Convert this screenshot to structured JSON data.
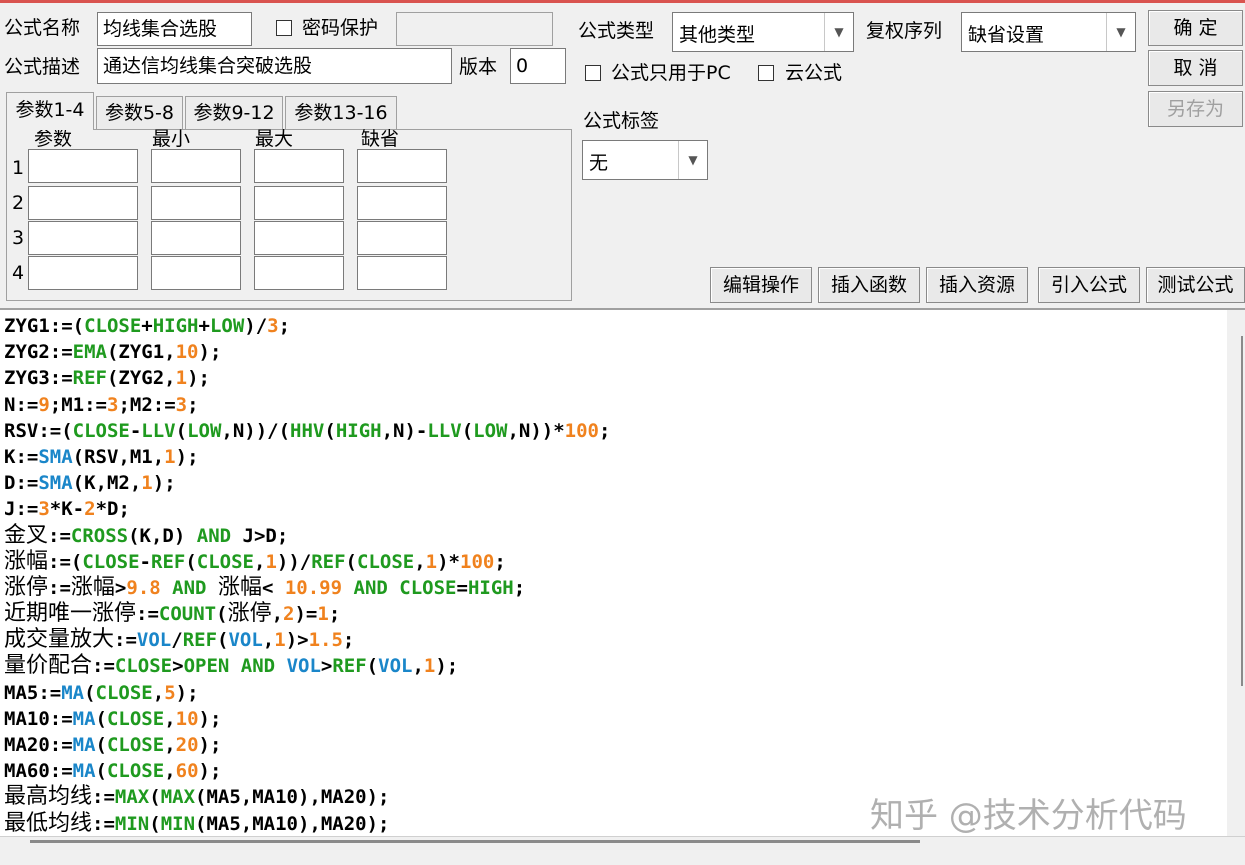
{
  "form": {
    "name_label": "公式名称",
    "name_value": "均线集合选股",
    "password_label": "密码保护",
    "desc_label": "公式描述",
    "desc_value": "通达信均线集合突破选股",
    "version_label": "版本",
    "version_value": "0",
    "type_label": "公式类型",
    "type_value": "其他类型",
    "rights_label": "复权序列",
    "rights_value": "缺省设置",
    "pc_only_label": "公式只用于PC",
    "cloud_label": "云公式",
    "tag_label": "公式标签",
    "tag_value": "无"
  },
  "buttons": {
    "ok": "确 定",
    "cancel": "取 消",
    "save_as": "另存为",
    "edit_ops": "编辑操作",
    "insert_func": "插入函数",
    "insert_res": "插入资源",
    "import_formula": "引入公式",
    "test_formula": "测试公式"
  },
  "params": {
    "tabs": [
      "参数1-4",
      "参数5-8",
      "参数9-12",
      "参数13-16"
    ],
    "headers": [
      "参数",
      "最小",
      "最大",
      "缺省"
    ],
    "rows": [
      "1",
      "2",
      "3",
      "4"
    ]
  },
  "colors": {
    "keyword": "#1f9a1f",
    "number": "#f0821e",
    "func_blue": "#1a86c9",
    "plain": "#000000"
  },
  "code_lines": [
    [
      [
        "ZYG1:=(",
        "p"
      ],
      [
        "CLOSE",
        "g"
      ],
      [
        "+",
        "p"
      ],
      [
        "HIGH",
        "g"
      ],
      [
        "+",
        "p"
      ],
      [
        "LOW",
        "g"
      ],
      [
        ")/",
        "p"
      ],
      [
        "3",
        "o"
      ],
      [
        ";",
        "p"
      ]
    ],
    [
      [
        "ZYG2:=",
        "p"
      ],
      [
        "EMA",
        "g"
      ],
      [
        "(ZYG1,",
        "p"
      ],
      [
        "10",
        "o"
      ],
      [
        ");",
        "p"
      ]
    ],
    [
      [
        "ZYG3:=",
        "p"
      ],
      [
        "REF",
        "g"
      ],
      [
        "(ZYG2,",
        "p"
      ],
      [
        "1",
        "o"
      ],
      [
        ");",
        "p"
      ]
    ],
    [
      [
        "N:=",
        "p"
      ],
      [
        "9",
        "o"
      ],
      [
        ";M1:=",
        "p"
      ],
      [
        "3",
        "o"
      ],
      [
        ";M2:=",
        "p"
      ],
      [
        "3",
        "o"
      ],
      [
        ";",
        "p"
      ]
    ],
    [
      [
        "RSV:=(",
        "p"
      ],
      [
        "CLOSE",
        "g"
      ],
      [
        "-",
        "p"
      ],
      [
        "LLV",
        "g"
      ],
      [
        "(",
        "p"
      ],
      [
        "LOW",
        "g"
      ],
      [
        ",N))/(",
        "p"
      ],
      [
        "HHV",
        "g"
      ],
      [
        "(",
        "p"
      ],
      [
        "HIGH",
        "g"
      ],
      [
        ",N)-",
        "p"
      ],
      [
        "LLV",
        "g"
      ],
      [
        "(",
        "p"
      ],
      [
        "LOW",
        "g"
      ],
      [
        ",N))*",
        "p"
      ],
      [
        "100",
        "o"
      ],
      [
        ";",
        "p"
      ]
    ],
    [
      [
        "K:=",
        "p"
      ],
      [
        "SMA",
        "b"
      ],
      [
        "(RSV,M1,",
        "p"
      ],
      [
        "1",
        "o"
      ],
      [
        ");",
        "p"
      ]
    ],
    [
      [
        "D:=",
        "p"
      ],
      [
        "SMA",
        "b"
      ],
      [
        "(K,M2,",
        "p"
      ],
      [
        "1",
        "o"
      ],
      [
        ");",
        "p"
      ]
    ],
    [
      [
        "J:=",
        "p"
      ],
      [
        "3",
        "o"
      ],
      [
        "*K-",
        "p"
      ],
      [
        "2",
        "o"
      ],
      [
        "*D;",
        "p"
      ]
    ],
    [
      [
        "金叉",
        "p"
      ],
      [
        ":=",
        "p"
      ],
      [
        "CROSS",
        "g"
      ],
      [
        "(K,D) ",
        "p"
      ],
      [
        "AND",
        "g"
      ],
      [
        " J>D;",
        "p"
      ]
    ],
    [
      [
        "涨幅",
        "p"
      ],
      [
        ":=(",
        "p"
      ],
      [
        "CLOSE",
        "g"
      ],
      [
        "-",
        "p"
      ],
      [
        "REF",
        "g"
      ],
      [
        "(",
        "p"
      ],
      [
        "CLOSE",
        "g"
      ],
      [
        ",",
        "p"
      ],
      [
        "1",
        "o"
      ],
      [
        "))/",
        "p"
      ],
      [
        "REF",
        "g"
      ],
      [
        "(",
        "p"
      ],
      [
        "CLOSE",
        "g"
      ],
      [
        ",",
        "p"
      ],
      [
        "1",
        "o"
      ],
      [
        ")*",
        "p"
      ],
      [
        "100",
        "o"
      ],
      [
        ";",
        "p"
      ]
    ],
    [
      [
        "涨停",
        "p"
      ],
      [
        ":=",
        "p"
      ],
      [
        "涨幅",
        "p"
      ],
      [
        ">",
        "p"
      ],
      [
        "9.8",
        "o"
      ],
      [
        " ",
        "p"
      ],
      [
        "AND",
        "g"
      ],
      [
        " ",
        "p"
      ],
      [
        "涨幅",
        "p"
      ],
      [
        "< ",
        "p"
      ],
      [
        "10.99",
        "o"
      ],
      [
        " ",
        "p"
      ],
      [
        "AND",
        "g"
      ],
      [
        " ",
        "p"
      ],
      [
        "CLOSE",
        "g"
      ],
      [
        "=",
        "p"
      ],
      [
        "HIGH",
        "g"
      ],
      [
        ";",
        "p"
      ]
    ],
    [
      [
        "近期唯一涨停",
        "p"
      ],
      [
        ":=",
        "p"
      ],
      [
        "COUNT",
        "g"
      ],
      [
        "(",
        "p"
      ],
      [
        "涨停",
        "p"
      ],
      [
        ",",
        "p"
      ],
      [
        "2",
        "o"
      ],
      [
        ")=",
        "p"
      ],
      [
        "1",
        "o"
      ],
      [
        ";",
        "p"
      ]
    ],
    [
      [
        "成交量放大",
        "p"
      ],
      [
        ":=",
        "p"
      ],
      [
        "VOL",
        "b"
      ],
      [
        "/",
        "p"
      ],
      [
        "REF",
        "g"
      ],
      [
        "(",
        "p"
      ],
      [
        "VOL",
        "b"
      ],
      [
        ",",
        "p"
      ],
      [
        "1",
        "o"
      ],
      [
        ")>",
        "p"
      ],
      [
        "1.5",
        "o"
      ],
      [
        ";",
        "p"
      ]
    ],
    [
      [
        "量价配合",
        "p"
      ],
      [
        ":=",
        "p"
      ],
      [
        "CLOSE",
        "g"
      ],
      [
        ">",
        "p"
      ],
      [
        "OPEN",
        "g"
      ],
      [
        " ",
        "p"
      ],
      [
        "AND",
        "g"
      ],
      [
        " ",
        "p"
      ],
      [
        "VOL",
        "b"
      ],
      [
        ">",
        "p"
      ],
      [
        "REF",
        "g"
      ],
      [
        "(",
        "p"
      ],
      [
        "VOL",
        "b"
      ],
      [
        ",",
        "p"
      ],
      [
        "1",
        "o"
      ],
      [
        ");",
        "p"
      ]
    ],
    [
      [
        "MA5:=",
        "p"
      ],
      [
        "MA",
        "b"
      ],
      [
        "(",
        "p"
      ],
      [
        "CLOSE",
        "g"
      ],
      [
        ",",
        "p"
      ],
      [
        "5",
        "o"
      ],
      [
        ");",
        "p"
      ]
    ],
    [
      [
        "MA10:=",
        "p"
      ],
      [
        "MA",
        "b"
      ],
      [
        "(",
        "p"
      ],
      [
        "CLOSE",
        "g"
      ],
      [
        ",",
        "p"
      ],
      [
        "10",
        "o"
      ],
      [
        ");",
        "p"
      ]
    ],
    [
      [
        "MA20:=",
        "p"
      ],
      [
        "MA",
        "b"
      ],
      [
        "(",
        "p"
      ],
      [
        "CLOSE",
        "g"
      ],
      [
        ",",
        "p"
      ],
      [
        "20",
        "o"
      ],
      [
        ");",
        "p"
      ]
    ],
    [
      [
        "MA60:=",
        "p"
      ],
      [
        "MA",
        "b"
      ],
      [
        "(",
        "p"
      ],
      [
        "CLOSE",
        "g"
      ],
      [
        ",",
        "p"
      ],
      [
        "60",
        "o"
      ],
      [
        ");",
        "p"
      ]
    ],
    [
      [
        "最高均线",
        "p"
      ],
      [
        ":=",
        "p"
      ],
      [
        "MAX",
        "g"
      ],
      [
        "(",
        "p"
      ],
      [
        "MAX",
        "g"
      ],
      [
        "(MA5,MA10),MA20);",
        "p"
      ]
    ],
    [
      [
        "最低均线",
        "p"
      ],
      [
        ":=",
        "p"
      ],
      [
        "MIN",
        "g"
      ],
      [
        "(",
        "p"
      ],
      [
        "MIN",
        "g"
      ],
      [
        "(MA5,MA10),MA20);",
        "p"
      ]
    ]
  ],
  "watermark": "知乎 @技术分析代码"
}
